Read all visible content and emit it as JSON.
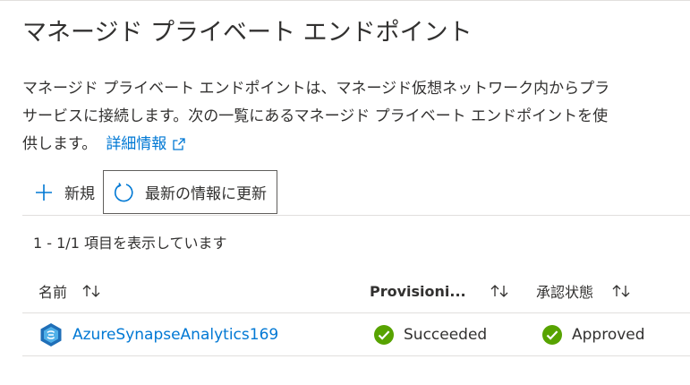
{
  "page": {
    "title": "マネージド プライベート エンドポイント",
    "description_line1": "マネージド プライベート エンドポイントは、マネージド仮想ネットワーク内からプラ",
    "description_line2": "サービスに接続します。次の一覧にあるマネージド プライベート エンドポイントを使",
    "description_line3": "供します。",
    "learn_more": "詳細情報"
  },
  "toolbar": {
    "new_label": "新規",
    "refresh_label": "最新の情報に更新"
  },
  "list": {
    "count_text": "1 - 1/1 項目を表示しています",
    "columns": [
      {
        "label": "名前"
      },
      {
        "label": "Provisioni..."
      },
      {
        "label": "承認状態"
      }
    ],
    "rows": [
      {
        "name": "AzureSynapseAnalytics169",
        "provisioning": "Succeeded",
        "approval": "Approved"
      }
    ]
  },
  "colors": {
    "accent": "#0078d4",
    "success": "#57a300",
    "text": "#323130",
    "border": "#e1dfdd"
  },
  "icons": {
    "new": "plus-icon",
    "refresh": "refresh-icon",
    "sort": "sort-icon",
    "success": "checkmark-circle-icon",
    "resource": "synapse-icon",
    "external": "external-link-icon"
  }
}
